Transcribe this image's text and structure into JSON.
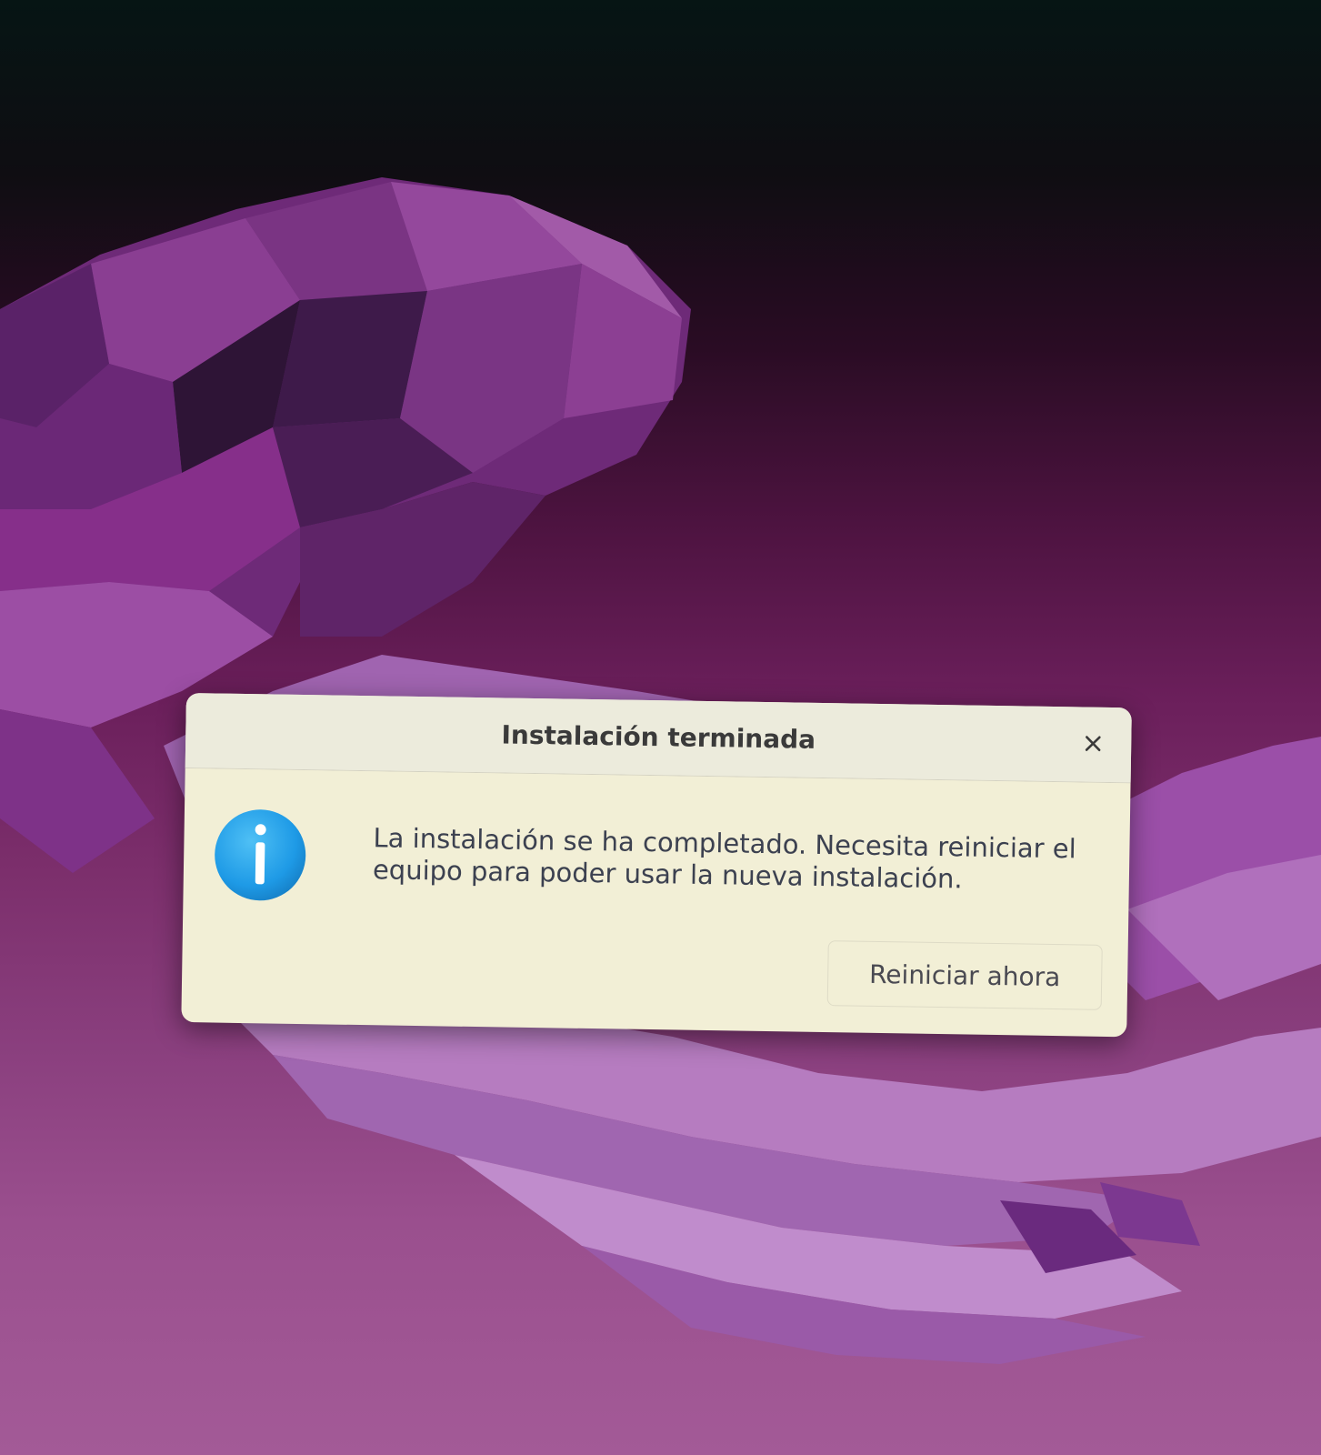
{
  "dialog": {
    "title": "Instalación terminada",
    "message": "La instalación se ha completado. Necesita reiniciar el equipo para poder usar la nueva instalación.",
    "restart_label": "Reiniciar ahora",
    "close_icon": "close-icon",
    "info_icon": "info-icon"
  },
  "colors": {
    "dialog_background": "#f2efd6",
    "info_icon": "#1e9ae6",
    "wallpaper_primary": "#7c2f6c"
  }
}
